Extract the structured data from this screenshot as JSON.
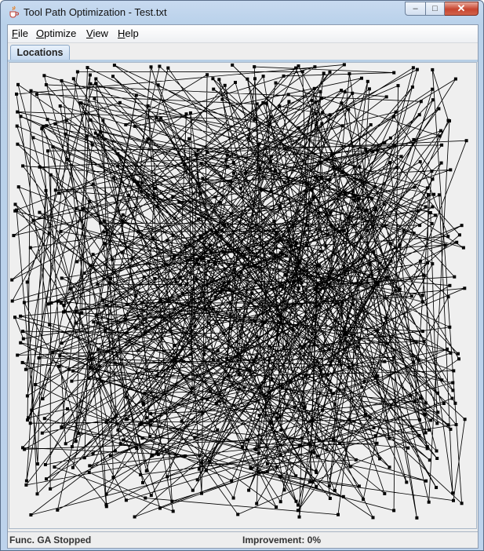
{
  "window": {
    "title": "Tool Path Optimization - Test.txt",
    "app_icon": "java-cup-icon",
    "controls": {
      "minimize": "–",
      "maximize": "□",
      "close": "✕"
    }
  },
  "menu": {
    "items": [
      {
        "label": "File"
      },
      {
        "label": "Optimize"
      },
      {
        "label": "View"
      },
      {
        "label": "Help"
      }
    ]
  },
  "tabs": [
    {
      "label": "Locations",
      "selected": true
    }
  ],
  "status": {
    "left": "Func. GA Stopped",
    "right": "Improvement: 0%"
  },
  "colors": {
    "path_line": "#000000",
    "node": "#000000",
    "canvas_bg": "#efefef"
  }
}
